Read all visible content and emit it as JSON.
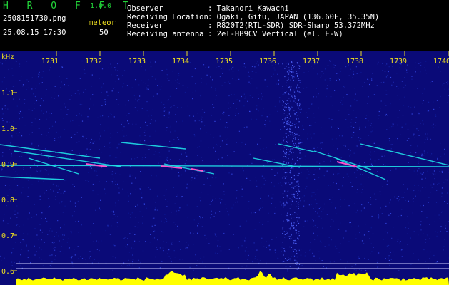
{
  "header": {
    "app_name": "H R O F F T",
    "version": "1.0.0",
    "filename": "2508151730.png",
    "meteor_label": "meteor",
    "timestamp": "25.08.15 17:30",
    "meteor_count": "50",
    "info": [
      {
        "key": "Observer",
        "value": ": Takanori Kawachi"
      },
      {
        "key": "Receiving Location",
        "value": ": Ogaki, Gifu, JAPAN (136.60E, 35.35N)"
      },
      {
        "key": "Receiver",
        "value": ": R820T2(RTL-SDR) SDR-Sharp 53.372MHz"
      },
      {
        "key": "Receiving antenna",
        "value": ": 2el-HB9CV Vertical (el. E-W)"
      }
    ]
  },
  "spectrogram": {
    "y_unit": "kHz",
    "y_ticks": [
      "1.1",
      "1.0",
      "0.9",
      "0.8",
      "0.7",
      "0.6"
    ],
    "x_ticks": [
      "1731",
      "1732",
      "1733",
      "1734",
      "1735",
      "1736",
      "1737",
      "1738",
      "1739",
      "1740"
    ],
    "colors": {
      "background": "#0a0a78",
      "trace": "#20e0e8",
      "hot": "#ff50c8",
      "level": "#ffff00",
      "scale": "#f0e020"
    }
  }
}
